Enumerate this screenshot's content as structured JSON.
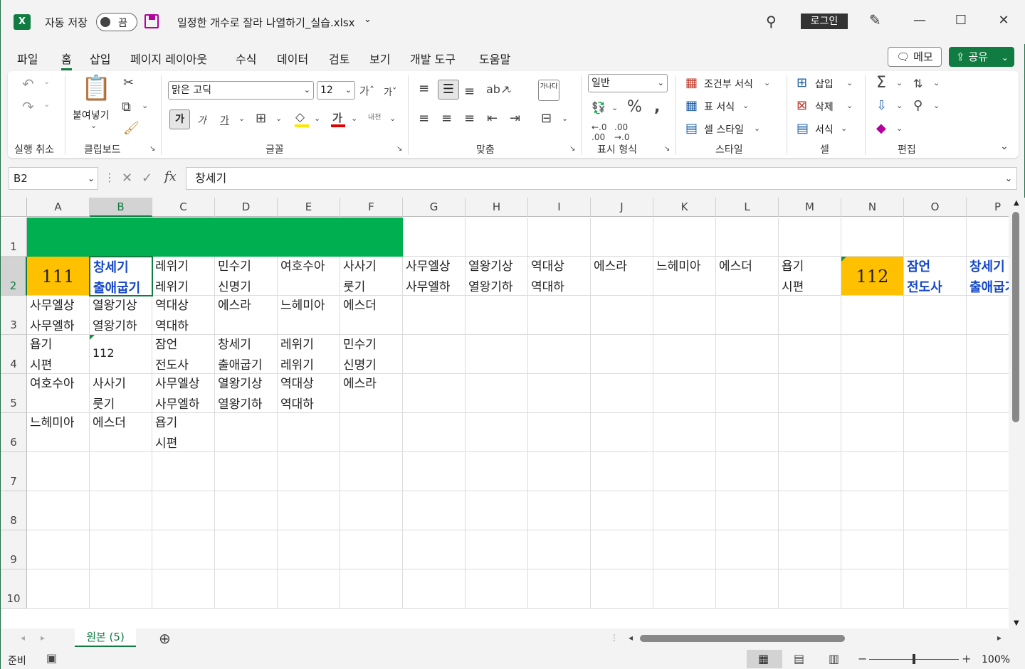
{
  "titlebar": {
    "autosave_label": "자동 저장",
    "toggle_state": "끔",
    "filename": "일정한 개수로 잘라 나열하기_실습.xlsx",
    "login": "로그인"
  },
  "menu": {
    "tabs": [
      "파일",
      "홈",
      "삽입",
      "페이지 레이아웃",
      "수식",
      "데이터",
      "검토",
      "보기",
      "개발 도구",
      "도움말"
    ],
    "memo": "메모",
    "share": "공유"
  },
  "ribbon": {
    "groups": {
      "undo": "실행 취소",
      "clipboard": "클립보드",
      "font": "글꼴",
      "align": "맞춤",
      "number": "표시 형식",
      "styles": "스타일",
      "cells": "셀",
      "editing": "편집"
    },
    "paste": "붙여넣기",
    "font_name": "맑은 고딕",
    "font_size": "12",
    "bold": "가",
    "italic": "가",
    "underline": "가",
    "font_color_glyph": "가",
    "phonetic": "내천",
    "wrap": "가나다",
    "number_format": "일반",
    "conditional": "조건부 서식",
    "table_format": "표 서식",
    "cell_style": "셀 스타일",
    "insert": "삽입",
    "delete": "삭제",
    "format": "서식",
    "colors": {
      "fill": "#ffe600",
      "font": "#e00000"
    }
  },
  "formula": {
    "name_box": "B2",
    "fx": "fx",
    "content": "창세기"
  },
  "grid": {
    "columns": [
      "A",
      "B",
      "C",
      "D",
      "E",
      "F",
      "G",
      "H",
      "I",
      "J",
      "K",
      "L",
      "M",
      "N",
      "O",
      "P"
    ],
    "rows": [
      "1",
      "2",
      "3",
      "4",
      "5",
      "6",
      "7",
      "8",
      "9",
      "10"
    ],
    "selected_col": "B",
    "selected_row": "2",
    "cells": [
      {
        "ref": "A2",
        "text": "111",
        "style": "big orange"
      },
      {
        "ref": "B2",
        "text": "창세기\n출애굽기",
        "style": "blue active"
      },
      {
        "ref": "C2",
        "text": "레위기\n레위기"
      },
      {
        "ref": "D2",
        "text": "민수기\n신명기"
      },
      {
        "ref": "E2",
        "text": "여호수아"
      },
      {
        "ref": "F2",
        "text": "사사기\n룻기"
      },
      {
        "ref": "G2",
        "text": "사무엘상\n사무엘하"
      },
      {
        "ref": "H2",
        "text": "열왕기상\n열왕기하"
      },
      {
        "ref": "I2",
        "text": "역대상\n역대하"
      },
      {
        "ref": "J2",
        "text": "에스라"
      },
      {
        "ref": "K2",
        "text": "느헤미아"
      },
      {
        "ref": "L2",
        "text": "에스더"
      },
      {
        "ref": "M2",
        "text": "욥기\n시편"
      },
      {
        "ref": "N2",
        "text": "112",
        "style": "big orange tri"
      },
      {
        "ref": "O2",
        "text": "잠언\n전도사",
        "style": "blue"
      },
      {
        "ref": "P2",
        "text": "창세기\n출애굽기",
        "style": "blue"
      },
      {
        "ref": "A3",
        "text": "사무엘상\n사무엘하"
      },
      {
        "ref": "B3",
        "text": "열왕기상\n열왕기하"
      },
      {
        "ref": "C3",
        "text": "역대상\n역대하"
      },
      {
        "ref": "D3",
        "text": "에스라"
      },
      {
        "ref": "E3",
        "text": "느헤미아"
      },
      {
        "ref": "F3",
        "text": "에스더"
      },
      {
        "ref": "A4",
        "text": "욥기\n시편"
      },
      {
        "ref": "B4",
        "text": "112",
        "style": "single tri"
      },
      {
        "ref": "C4",
        "text": "잠언\n전도사"
      },
      {
        "ref": "D4",
        "text": "창세기\n출애굽기"
      },
      {
        "ref": "E4",
        "text": "레위기\n레위기"
      },
      {
        "ref": "F4",
        "text": "민수기\n신명기"
      },
      {
        "ref": "A5",
        "text": "여호수아"
      },
      {
        "ref": "B5",
        "text": "사사기\n룻기"
      },
      {
        "ref": "C5",
        "text": "사무엘상\n사무엘하"
      },
      {
        "ref": "D5",
        "text": "열왕기상\n열왕기하"
      },
      {
        "ref": "E5",
        "text": "역대상\n역대하"
      },
      {
        "ref": "F5",
        "text": "에스라"
      },
      {
        "ref": "A6",
        "text": "느헤미아"
      },
      {
        "ref": "B6",
        "text": "에스더"
      },
      {
        "ref": "C6",
        "text": "욥기\n시편"
      }
    ],
    "fill_colors": {
      "header_band": "#00b050",
      "highlight": "#ffc000"
    }
  },
  "sheets": {
    "active": "원본 (5)"
  },
  "status": {
    "ready": "준비",
    "zoom": "100%"
  }
}
